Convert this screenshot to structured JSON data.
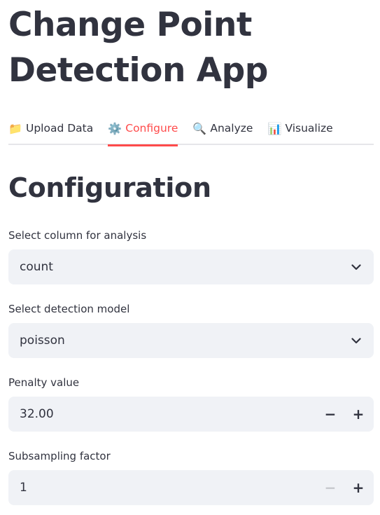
{
  "app": {
    "title_line1": "Change Point",
    "title_line2": "Detection App"
  },
  "tabs": [
    {
      "emoji": "📁",
      "label": "Upload Data",
      "active": false
    },
    {
      "emoji": "⚙️",
      "label": "Configure",
      "active": true
    },
    {
      "emoji": "🔍",
      "label": "Analyze",
      "active": false
    },
    {
      "emoji": "📊",
      "label": "Visualize",
      "active": false
    }
  ],
  "section": {
    "title": "Configuration"
  },
  "fields": {
    "column": {
      "label": "Select column for analysis",
      "value": "count"
    },
    "model": {
      "label": "Select detection model",
      "value": "poisson"
    },
    "penalty": {
      "label": "Penalty value",
      "value": "32.00",
      "minus": "−",
      "plus": "+"
    },
    "subsampling": {
      "label": "Subsampling factor",
      "value": "1",
      "minus": "−",
      "plus": "+"
    }
  },
  "colors": {
    "accent": "#ff4b4b",
    "input_bg": "#f0f2f6",
    "text": "#31333f"
  },
  "icons": {
    "select_caret": "chevron-down-icon"
  }
}
